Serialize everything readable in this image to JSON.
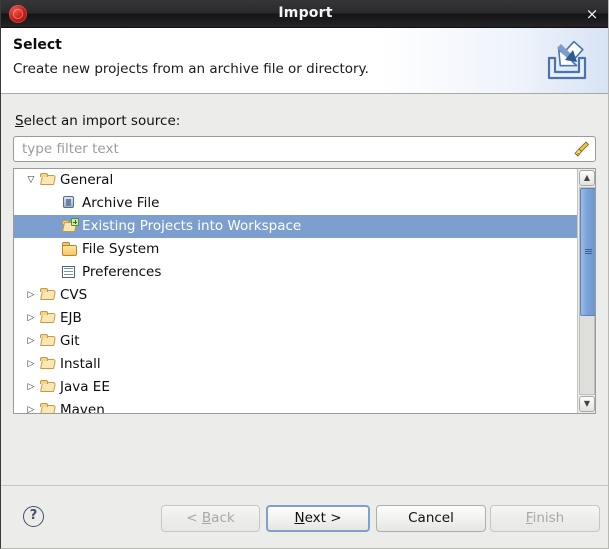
{
  "window": {
    "title": "Import",
    "app_icon": "eclipse-icon",
    "close_label": "×"
  },
  "header": {
    "title": "Select",
    "description": "Create new projects from an archive file or directory.",
    "icon": "import-wizard-icon"
  },
  "form": {
    "source_label_prefix": "S",
    "source_label_rest": "elect an import source:",
    "filter": {
      "value": "",
      "placeholder": "type filter text",
      "clear_icon": "broom-icon"
    }
  },
  "tree": {
    "items": [
      {
        "label": "General",
        "icon": "folder-open-icon",
        "level": 0,
        "expanded": true,
        "has_children": true,
        "selected": false,
        "twisty": "▽"
      },
      {
        "label": "Archive File",
        "icon": "archive-file-icon",
        "level": 1,
        "expanded": false,
        "has_children": false,
        "selected": false,
        "twisty": ""
      },
      {
        "label": "Existing Projects into Workspace",
        "icon": "projects-import-icon",
        "level": 1,
        "expanded": false,
        "has_children": false,
        "selected": true,
        "twisty": ""
      },
      {
        "label": "File System",
        "icon": "folder-closed-icon",
        "level": 1,
        "expanded": false,
        "has_children": false,
        "selected": false,
        "twisty": ""
      },
      {
        "label": "Preferences",
        "icon": "preferences-icon",
        "level": 1,
        "expanded": false,
        "has_children": false,
        "selected": false,
        "twisty": ""
      },
      {
        "label": "CVS",
        "icon": "folder-open-icon",
        "level": 0,
        "expanded": false,
        "has_children": true,
        "selected": false,
        "twisty": "▷"
      },
      {
        "label": "EJB",
        "icon": "folder-open-icon",
        "level": 0,
        "expanded": false,
        "has_children": true,
        "selected": false,
        "twisty": "▷"
      },
      {
        "label": "Git",
        "icon": "folder-open-icon",
        "level": 0,
        "expanded": false,
        "has_children": true,
        "selected": false,
        "twisty": "▷"
      },
      {
        "label": "Install",
        "icon": "folder-open-icon",
        "level": 0,
        "expanded": false,
        "has_children": true,
        "selected": false,
        "twisty": "▷"
      },
      {
        "label": "Java EE",
        "icon": "folder-open-icon",
        "level": 0,
        "expanded": false,
        "has_children": true,
        "selected": false,
        "twisty": "▷"
      },
      {
        "label": "Maven",
        "icon": "folder-open-icon",
        "level": 0,
        "expanded": false,
        "has_children": true,
        "selected": false,
        "twisty": "▷"
      }
    ],
    "scrollbar": {
      "up_arrow": "▲",
      "down_arrow": "▼"
    }
  },
  "footer": {
    "help_label": "?",
    "buttons": [
      {
        "name": "back",
        "prefix": "< ",
        "mnemonic": "B",
        "suffix": "ack",
        "enabled": false,
        "default": false
      },
      {
        "name": "next",
        "prefix": "",
        "mnemonic": "N",
        "suffix": "ext >",
        "enabled": true,
        "default": true
      },
      {
        "name": "cancel",
        "prefix": "",
        "mnemonic": "",
        "suffix": "Cancel",
        "enabled": true,
        "default": false
      },
      {
        "name": "finish",
        "prefix": "",
        "mnemonic": "F",
        "suffix": "inish",
        "enabled": false,
        "default": false
      }
    ]
  },
  "colors": {
    "selection": "#7d9fd0",
    "titlebar": "#242426",
    "dialog_bg": "#ececea",
    "scroll_thumb": "#7ba2d8"
  }
}
